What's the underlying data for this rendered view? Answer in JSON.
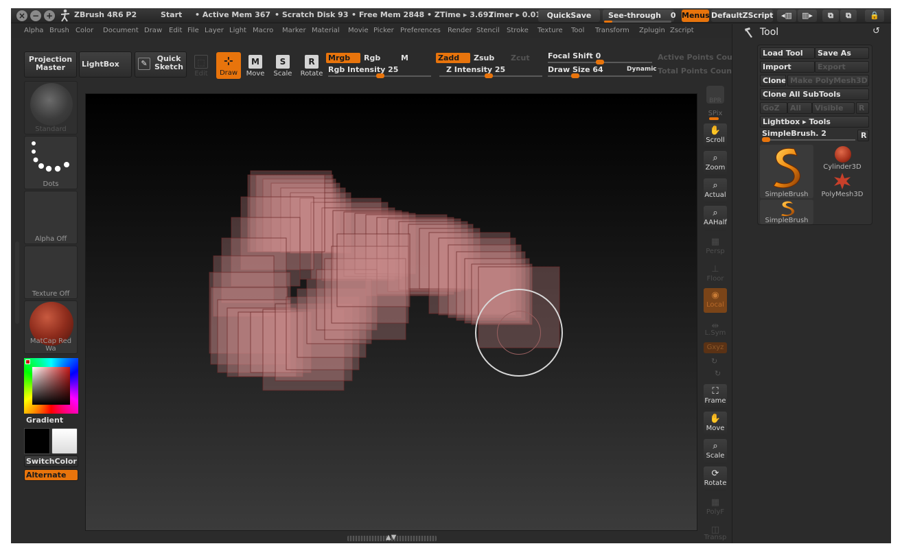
{
  "titlebar": {
    "app": "ZBrush 4R6 P2",
    "start": "Start",
    "active_mem": "• Active Mem 367",
    "scratch_disk": "• Scratch Disk 93",
    "free_mem": "• Free Mem 2848",
    "ztime": "• ZTime ▸ 3.692",
    "timer": "Timer ▸ 0.01",
    "quicksave": "QuickSave",
    "see_through": "See-through",
    "see_through_value": "0",
    "menus": "Menus",
    "default_script": "DefaultZScript"
  },
  "menubar": {
    "items": [
      "Alpha",
      "Brush",
      "Color",
      "Document",
      "Draw",
      "Edit",
      "File",
      "Layer",
      "Light",
      "Macro",
      "Marker",
      "Material",
      "Movie",
      "Picker",
      "Preferences",
      "Render",
      "Stencil",
      "Stroke",
      "Texture",
      "Tool",
      "Transform",
      "Zplugin",
      "Zscript"
    ]
  },
  "shelf": {
    "projection_master": "Projection Master",
    "lightbox": "LightBox",
    "quick_sketch": "Quick Sketch",
    "edit": "Edit",
    "draw": "Draw",
    "move": "Move",
    "scale": "Scale",
    "rotate": "Rotate",
    "mrgb": "Mrgb",
    "rgb": "Rgb",
    "m": "M",
    "zadd": "Zadd",
    "zsub": "Zsub",
    "zcut": "Zcut",
    "rgb_intensity_label": "Rgb Intensity",
    "rgb_intensity": "25",
    "z_intensity_label": "Z Intensity",
    "z_intensity": "25",
    "focal_shift_label": "Focal Shift",
    "focal_shift": "0",
    "draw_size_label": "Draw Size",
    "draw_size": "64",
    "dynamic": "Dynamic",
    "active_points": "Active Points Cou",
    "total_points": "Total Points Coun"
  },
  "left": {
    "brush_caption": "Standard",
    "stroke_caption": "Dots",
    "alpha_caption": "Alpha  Off",
    "texture_caption": "Texture  Off",
    "material_caption": "MatCap  Red  Wa",
    "gradient": "Gradient",
    "switch_color": "SwitchColor",
    "alternate": "Alternate"
  },
  "right_shelf": {
    "bpr": "BPR",
    "spix": "SPix",
    "scroll": "Scroll",
    "zoom": "Zoom",
    "actual": "Actual",
    "aahalf": "AAHalf",
    "persp": "Persp",
    "floor": "Floor",
    "local": "Local",
    "lsym": "L.Sym",
    "gxyz": "Gxyz",
    "frame": "Frame",
    "move": "Move",
    "scale": "Scale",
    "rotate": "Rotate",
    "polyf": "PolyF",
    "transp": "Transp"
  },
  "tool_panel": {
    "title": "Tool",
    "load_tool": "Load Tool",
    "save_as": "Save As",
    "import": "Import",
    "export": "Export",
    "clone": "Clone",
    "make_polymesh": "Make PolyMesh3D",
    "clone_all_subtools": "Clone All SubTools",
    "goz": "GoZ",
    "all": "All",
    "visible": "Visible",
    "r_small": "R",
    "lightbox_tools": "Lightbox ▸ Tools",
    "simplebrush_slider": "SimpleBrush.  2",
    "r_button": "R",
    "thumbs": [
      "SimpleBrush",
      "Cylinder3D",
      "PolyMesh3D",
      "SimpleBrush"
    ]
  },
  "colors": {
    "accent": "#e8740c",
    "panel": "#2b2b2b",
    "stroke_fill": "#c7898a"
  }
}
